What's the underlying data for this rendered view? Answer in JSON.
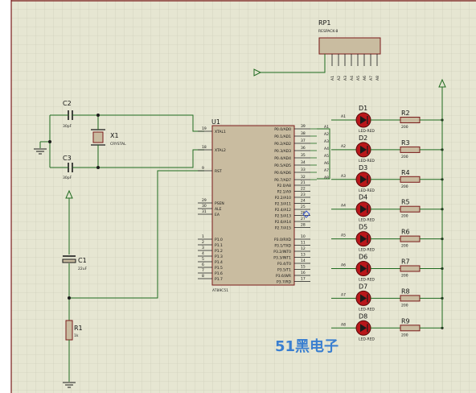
{
  "colors": {
    "background": "#e6e6d2",
    "grid": "#c8c8b4",
    "wire": "#1f6b1f",
    "body_fill": "#c9bca0",
    "led_fill": "#b8161a",
    "watermark": "#3a7fd0"
  },
  "components": {
    "rp1": {
      "ref": "RP1",
      "part": "RESPACK-8",
      "pins": [
        "A1",
        "A2",
        "A3",
        "A4",
        "A5",
        "A6",
        "A7",
        "A8"
      ]
    },
    "c2": {
      "ref": "C2",
      "value": "30pF"
    },
    "c3": {
      "ref": "C3",
      "value": "30pF"
    },
    "x1": {
      "ref": "X1",
      "part": "CRYSTAL"
    },
    "c1": {
      "ref": "C1",
      "value": "22uF"
    },
    "r1": {
      "ref": "R1",
      "value": "1k"
    },
    "u1": {
      "ref": "U1",
      "part": "AT89C51",
      "left_pins": [
        {
          "num": "19",
          "name": "XTAL1"
        },
        {
          "num": "18",
          "name": "XTAL2"
        },
        {
          "num": "9",
          "name": "RST"
        },
        {
          "num": "29",
          "name": "PSEN"
        },
        {
          "num": "30",
          "name": "ALE"
        },
        {
          "num": "31",
          "name": "EA"
        },
        {
          "num": "1",
          "name": "P1.0"
        },
        {
          "num": "2",
          "name": "P1.1"
        },
        {
          "num": "3",
          "name": "P1.2"
        },
        {
          "num": "4",
          "name": "P1.3"
        },
        {
          "num": "5",
          "name": "P1.4"
        },
        {
          "num": "6",
          "name": "P1.5"
        },
        {
          "num": "7",
          "name": "P1.6"
        },
        {
          "num": "8",
          "name": "P1.7"
        }
      ],
      "right_pins": [
        {
          "num": "39",
          "name": "P0.0/AD0"
        },
        {
          "num": "38",
          "name": "P0.1/AD1"
        },
        {
          "num": "37",
          "name": "P0.2/AD2"
        },
        {
          "num": "36",
          "name": "P0.3/AD3"
        },
        {
          "num": "35",
          "name": "P0.4/AD4"
        },
        {
          "num": "34",
          "name": "P0.5/AD5"
        },
        {
          "num": "33",
          "name": "P0.6/AD6"
        },
        {
          "num": "32",
          "name": "P0.7/AD7"
        },
        {
          "num": "21",
          "name": "P2.0/A8"
        },
        {
          "num": "22",
          "name": "P2.1/A9"
        },
        {
          "num": "23",
          "name": "P2.2/A10"
        },
        {
          "num": "24",
          "name": "P2.3/A11"
        },
        {
          "num": "25",
          "name": "P2.4/A12"
        },
        {
          "num": "26",
          "name": "P2.5/A13"
        },
        {
          "num": "27",
          "name": "P2.6/A14"
        },
        {
          "num": "28",
          "name": "P2.7/A15"
        },
        {
          "num": "10",
          "name": "P3.0/RXD"
        },
        {
          "num": "11",
          "name": "P3.1/TXD"
        },
        {
          "num": "12",
          "name": "P3.2/INT0"
        },
        {
          "num": "13",
          "name": "P3.3/INT1"
        },
        {
          "num": "14",
          "name": "P3.4/T0"
        },
        {
          "num": "15",
          "name": "P3.5/T1"
        },
        {
          "num": "16",
          "name": "P3.6/WR"
        },
        {
          "num": "17",
          "name": "P3.7/RD"
        }
      ]
    },
    "led_rows": [
      {
        "net": "A1",
        "led": "D1",
        "led_part": "LED-RED",
        "res": "R2",
        "res_value": "200"
      },
      {
        "net": "A2",
        "led": "D2",
        "led_part": "LED-RED",
        "res": "R3",
        "res_value": "200"
      },
      {
        "net": "A3",
        "led": "D3",
        "led_part": "LED-RED",
        "res": "R4",
        "res_value": "200"
      },
      {
        "net": "A4",
        "led": "D4",
        "led_part": "LED-RED",
        "res": "R5",
        "res_value": "200"
      },
      {
        "net": "A5",
        "led": "D5",
        "led_part": "LED-RED",
        "res": "R6",
        "res_value": "200"
      },
      {
        "net": "A6",
        "led": "D6",
        "led_part": "LED-RED",
        "res": "R7",
        "res_value": "200"
      },
      {
        "net": "A7",
        "led": "D7",
        "led_part": "LED-RED",
        "res": "R8",
        "res_value": "200"
      },
      {
        "net": "A8",
        "led": "D8",
        "led_part": "LED-RED",
        "res": "R9",
        "res_value": "200"
      }
    ]
  },
  "watermark": "51黑电子"
}
